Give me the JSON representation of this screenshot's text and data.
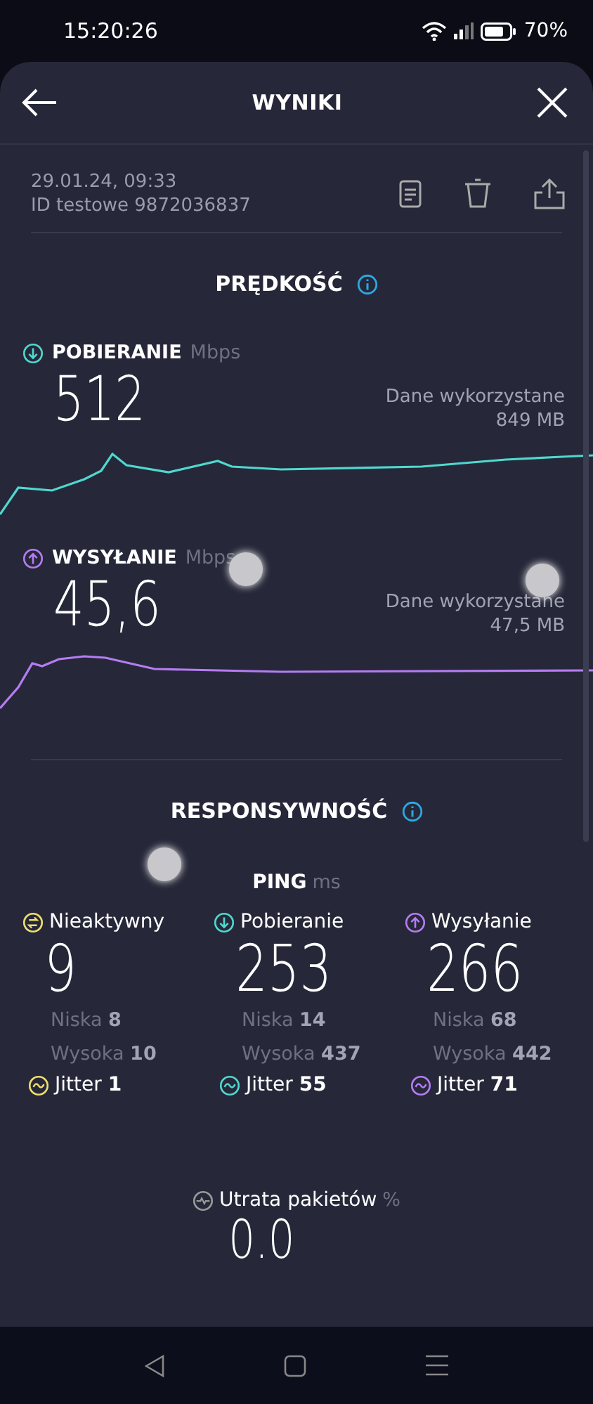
{
  "status_bar": {
    "time": "15:20:26",
    "battery": "70%"
  },
  "header": {
    "title": "WYNIKI"
  },
  "result": {
    "date": "29.01.24, 09:33",
    "test_id": "ID testowe 9872036837"
  },
  "speed": {
    "title": "PRĘDKOŚĆ",
    "metrics": [
      {
        "kind": "download",
        "label": "POBIERANIE",
        "unit": "Mbps",
        "value": "512",
        "data_label": "Dane wykorzystane",
        "data_value": "849 MB"
      },
      {
        "kind": "upload",
        "label": "WYSYŁANIE",
        "unit": "Mbps",
        "value": "45,6",
        "data_label": "Dane wykorzystane",
        "data_value": "47,5 MB"
      }
    ]
  },
  "responsiveness": {
    "title": "RESPONSYWNOŚĆ",
    "ping_label": "PING",
    "ping_unit": "ms",
    "columns": [
      {
        "kind": "idle",
        "label": "Nieaktywny",
        "value": "9",
        "low_label": "Niska",
        "low": "8",
        "high_label": "Wysoka",
        "high": "10",
        "jitter_label": "Jitter",
        "jitter": "1"
      },
      {
        "kind": "download",
        "label": "Pobieranie",
        "value": "253",
        "low_label": "Niska",
        "low": "14",
        "high_label": "Wysoka",
        "high": "437",
        "jitter_label": "Jitter",
        "jitter": "55"
      },
      {
        "kind": "upload",
        "label": "Wysyłanie",
        "value": "266",
        "low_label": "Niska",
        "low": "68",
        "high_label": "Wysoka",
        "high": "442",
        "jitter_label": "Jitter",
        "jitter": "71"
      }
    ]
  },
  "packet_loss": {
    "label": "Utrata pakietów",
    "unit": "%",
    "value": "0.0"
  }
}
